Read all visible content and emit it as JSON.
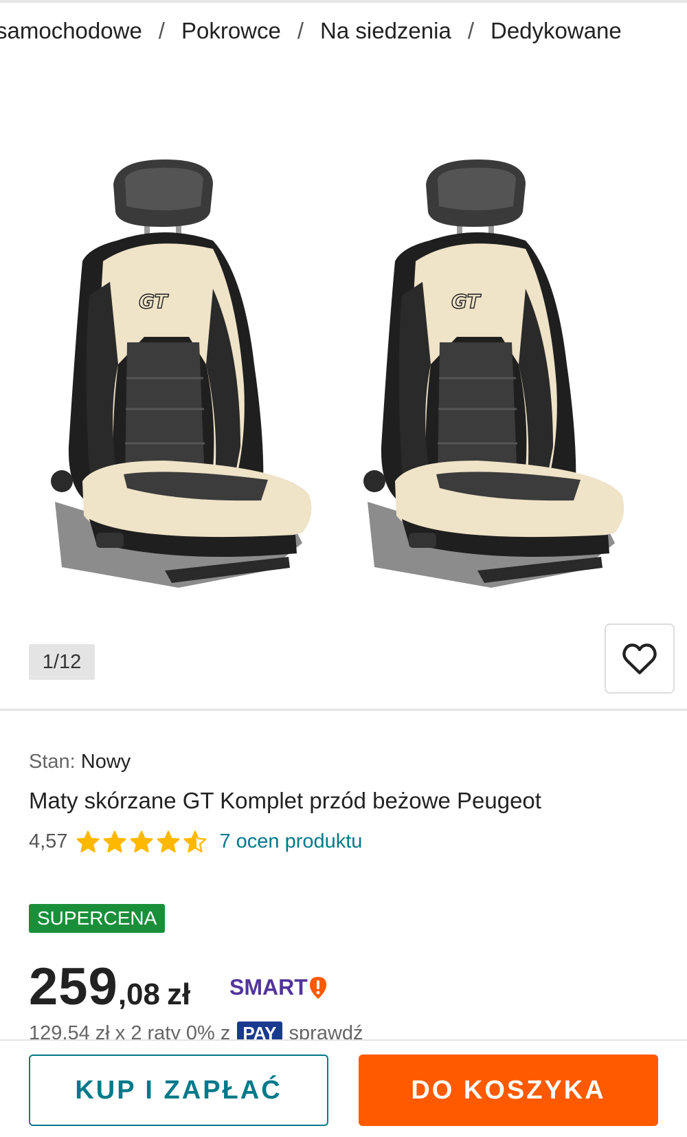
{
  "breadcrumb": {
    "items": [
      "samochodowe",
      "Pokrowce",
      "Na siedzenia",
      "Dedykowane"
    ],
    "separator": "/"
  },
  "gallery": {
    "counter": "1/12",
    "logo_text": "GT",
    "favorite_icon": "heart-outline-icon"
  },
  "product": {
    "condition_label": "Stan:",
    "condition_value": "Nowy",
    "title": "Maty skórzane GT Komplet przód beżowe Peugeot",
    "rating_value": "4,57",
    "rating_stars": 4.57,
    "rating_max": 5,
    "reviews_link": "7 ocen produktu",
    "badge": "SUPERCENA",
    "price_integer": "259",
    "price_fraction": ",08",
    "price_currency": "zł",
    "smart_label": "SMART",
    "installments_text": "129,54 zł x 2 raty 0% z",
    "installments_pay_logo": "PAY",
    "installments_link": "sprawdź"
  },
  "actions": {
    "buy_now": "KUP I ZAPŁAĆ",
    "add_to_cart": "DO KOSZYKA"
  },
  "colors": {
    "teal": "#00798a",
    "orange": "#ff5a00",
    "green_badge": "#1a8f3a",
    "smart_purple": "#52359a",
    "star": "#ffb800",
    "seat_beige": "#efe3c8"
  }
}
